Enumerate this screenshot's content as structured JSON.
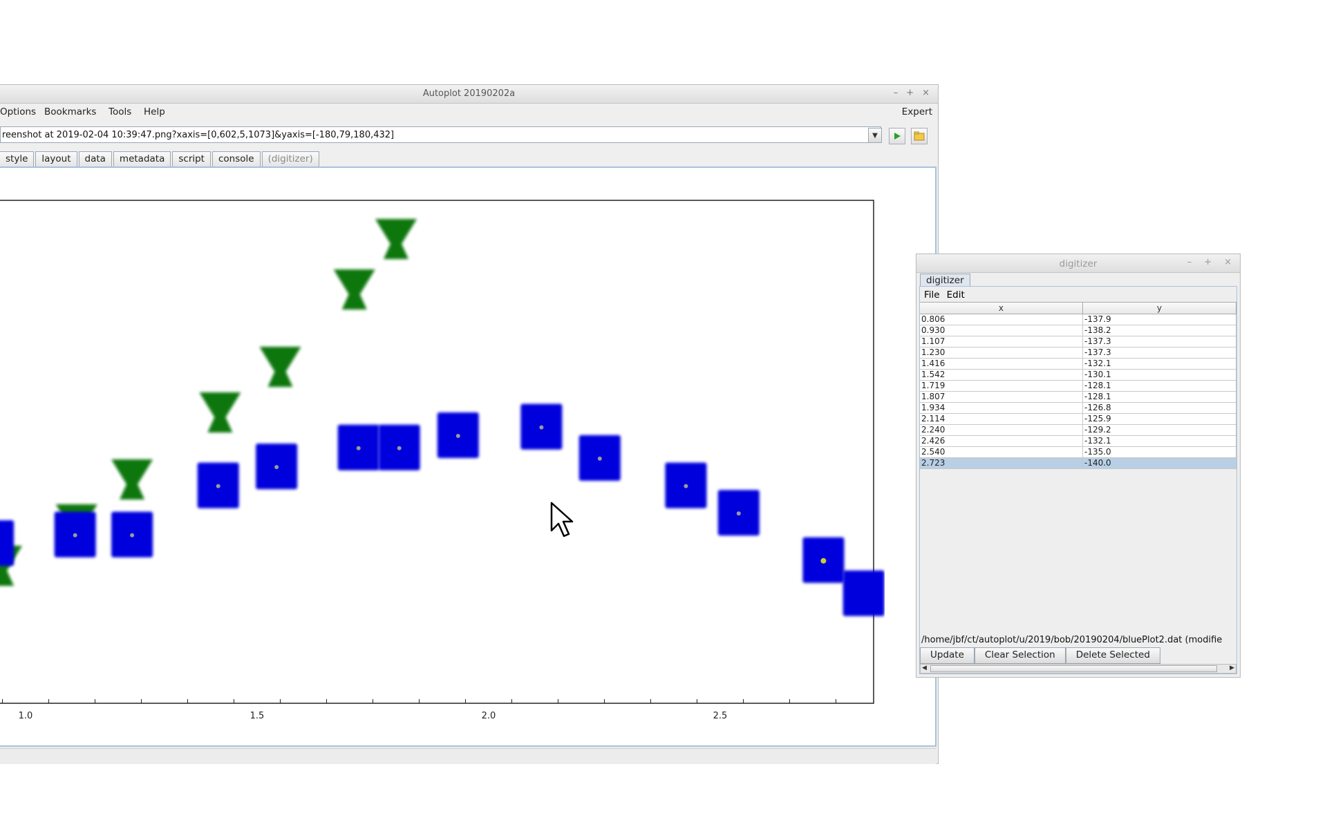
{
  "main_window": {
    "title": "Autoplot 20190202a",
    "wm": {
      "minimize": "–",
      "maximize": "+",
      "close": "×"
    },
    "menu": [
      "Options",
      "Bookmarks",
      "Tools",
      "Help"
    ],
    "expert_label": "Expert",
    "url": "reenshot at 2019-02-04 10:39:47.png?xaxis=[0,602,5,1073]&yaxis=[-180,79,180,432]",
    "tabs": [
      "style",
      "layout",
      "data",
      "metadata",
      "script",
      "console",
      "(digitizer)"
    ]
  },
  "chart_data": {
    "type": "scatter",
    "x_ticks": [
      "1.0",
      "1.5",
      "2.0",
      "2.5"
    ],
    "series": [
      {
        "marker": "square",
        "color": "#0000dd",
        "x": [
          0.806,
          0.93,
          1.107,
          1.23,
          1.416,
          1.542,
          1.719,
          1.807,
          1.934,
          2.114,
          2.24,
          2.426,
          2.54,
          2.723,
          2.81
        ]
      },
      {
        "marker": "triangle-down",
        "color": "#117711",
        "x": [
          1.0,
          1.11,
          1.23,
          1.42,
          1.55,
          1.71,
          1.8
        ]
      }
    ],
    "digitized_points": {
      "x": [
        0.806,
        0.93,
        1.107,
        1.23,
        1.416,
        1.542,
        1.719,
        1.807,
        1.934,
        2.114,
        2.24,
        2.426,
        2.54,
        2.723
      ],
      "y": [
        -137.9,
        -138.2,
        -137.3,
        -137.3,
        -132.1,
        -130.1,
        -128.1,
        -128.1,
        -126.8,
        -125.9,
        -129.2,
        -132.1,
        -135.0,
        -140.0
      ]
    }
  },
  "digitizer": {
    "title": "digitizer",
    "wm": {
      "minimize": "–",
      "maximize": "+",
      "close": "×"
    },
    "tab": "digitizer",
    "menu": {
      "file": "File",
      "edit": "Edit"
    },
    "columns": {
      "x": "x",
      "y": "y"
    },
    "rows": [
      {
        "x": "0.806",
        "y": "-137.9"
      },
      {
        "x": "0.930",
        "y": "-138.2"
      },
      {
        "x": "1.107",
        "y": "-137.3"
      },
      {
        "x": "1.230",
        "y": "-137.3"
      },
      {
        "x": "1.416",
        "y": "-132.1"
      },
      {
        "x": "1.542",
        "y": "-130.1"
      },
      {
        "x": "1.719",
        "y": "-128.1"
      },
      {
        "x": "1.807",
        "y": "-128.1"
      },
      {
        "x": "1.934",
        "y": "-126.8"
      },
      {
        "x": "2.114",
        "y": "-125.9"
      },
      {
        "x": "2.240",
        "y": "-129.2"
      },
      {
        "x": "2.426",
        "y": "-132.1"
      },
      {
        "x": "2.540",
        "y": "-135.0"
      },
      {
        "x": "2.723",
        "y": "-140.0"
      }
    ],
    "selected_index": 13,
    "path": "/home/jbf/ct/autoplot/u/2019/bob/20190204/bluePlot2.dat (modifie",
    "buttons": {
      "update": "Update",
      "clear": "Clear Selection",
      "delete": "Delete Selected"
    }
  }
}
